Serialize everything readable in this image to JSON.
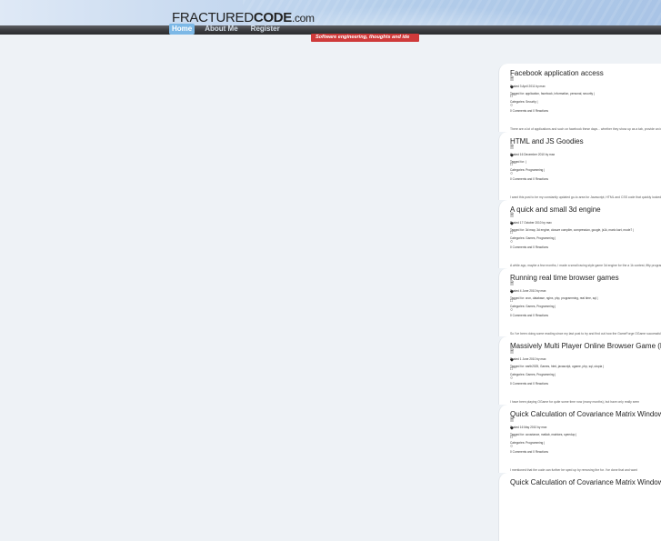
{
  "header": {
    "logo": {
      "part1": "FRACTURED",
      "part2": "CODE",
      "part3": ".com"
    },
    "tagline": "Software engineering, thoughts and ide",
    "nav": [
      {
        "label": "Home"
      },
      {
        "label": "About Me"
      },
      {
        "label": "Register"
      }
    ]
  },
  "posts": [
    {
      "title": "Facebook application access",
      "posted": "Posted 3 April 2011 by max",
      "tags": "Tagged for: application, facebook, information, personal, security |",
      "categories": "Categories: Security |",
      "comments": "0 Comments and 0 Reactions",
      "excerpt": "There are a lot of applications and such on facebook these days... whether they show up as a tab, provide an interesting video, a mafia tab, a girl getting kicked in the face eh... They all request"
    },
    {
      "title": "HTML and JS Goodies",
      "posted": "Posted 16 December 2010 by max",
      "tags": "Tagged for: |",
      "categories": "Categories: Programming |",
      "comments": "0 Comments and 0 Reactions",
      "excerpt": "I want this post to be my constantly updated go-to area for Javascript, HTML and CSS code that quickly looked up."
    },
    {
      "title": "A quick and small 3d engine",
      "posted": "Posted 17 October 2010 by max",
      "tags": "Tagged for: 3d map, 3d engine, closure compiler, compression, google, js1k, mario kart, mode7 |",
      "categories": "Categories: Games, Programming |",
      "comments": "0 Comments and 0 Reactions",
      "excerpt": "A while ago, maybe a few months, I made a small racing style game 3d engine for the a 1k contest, fifty program in under 1k of program code. Unfortunately there was a submission error after"
    },
    {
      "title": "Running real time browser games",
      "posted": "Posted 4 June 2010 by max",
      "tags": "Tagged for: cron, database, nginx, php, programming, real time, sql |",
      "categories": "Categories: Games, Programming |",
      "comments": "0 Comments and 0 Reactions",
      "excerpt": "So I've been doing some reading since my last post to try and find out how the GameForge OGame successful at creating this online game that is seemingly real-time, reliable and playable by the"
    },
    {
      "title": "Massively Multi Player Online Browser Game (MMOBG)",
      "posted": "Posted 1 June 2010 by max",
      "tags": "Tagged for: earth2025, Games, html, javascript, ogame, php, sql, utopia |",
      "categories": "Categories: Games, Programming |",
      "comments": "0 Comments and 0 Reactions",
      "excerpt": "I have been playing OGame for quite some time now (many months), but have only really seen"
    },
    {
      "title": "Quick Calculation of Covariance Matrix Windows II",
      "posted": "Posted 16 May 2010 by max",
      "tags": "Tagged for: covariance, matlab, matrices, speedup |",
      "categories": "Categories: Programming |",
      "comments": "0 Comments and 0 Reactions",
      "excerpt": "I mentioned that the code can further be sped up by removing the for. I've done that and want"
    },
    {
      "title": "Quick Calculation of Covariance Matrix Windows",
      "posted": "",
      "tags": "",
      "categories": "",
      "comments": "",
      "excerpt": ""
    }
  ],
  "icons": {
    "posted": "doc-icon",
    "tags": "tag-icon",
    "categories": "folder-icon",
    "comments": "comment-icon"
  }
}
